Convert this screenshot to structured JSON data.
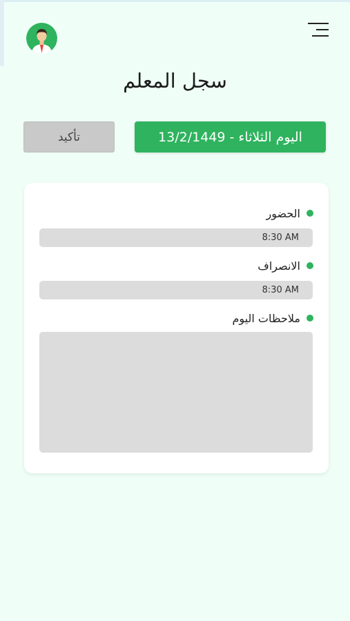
{
  "header": {
    "title": "سجل المعلم",
    "menu_icon": "hamburger-menu-icon",
    "avatar_icon": "user-avatar-icon"
  },
  "date_bar": {
    "date_label": "اليوم الثلاثاء - 13/2/1449",
    "confirm_label": "تأكيد"
  },
  "attendance": {
    "check_in_label": "الحضور",
    "check_in_time": "8:30 AM",
    "check_out_label": "الانصراف",
    "check_out_time": "8:30 AM",
    "notes_label": "ملاحظات اليوم",
    "notes_value": ""
  },
  "colors": {
    "background": "#effff7",
    "accent": "#2fb35e",
    "field": "#dcdcdc",
    "button_gray": "#c9c9c9"
  }
}
